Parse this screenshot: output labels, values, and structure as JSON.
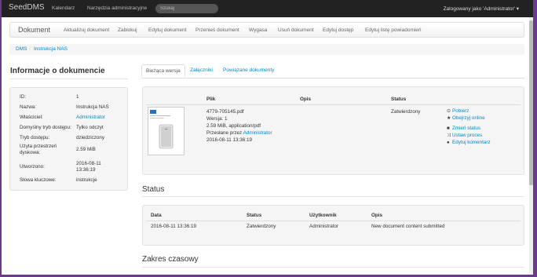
{
  "navbar": {
    "brand": "SeedDMS",
    "links": [
      "Kalendarz",
      "Narzędzia administracyjne"
    ],
    "search_placeholder": "Szukaj",
    "user": "Zalogowany jako 'Administrator' ▾"
  },
  "menubar": {
    "title": "Dokument",
    "items": [
      "Aktualizuj dokument",
      "Zablokuj",
      "Edytuj dokument",
      "Przenieś dokument",
      "Wygasa",
      "Usuń dokument",
      "Edytuj dostęp",
      "Edytuj listę powiadomień"
    ]
  },
  "breadcrumb": [
    "DMS",
    "Instrukcja NAS"
  ],
  "sidebar": {
    "heading": "Informacje o dokumencie",
    "rows": [
      {
        "label": "ID:",
        "value": "1"
      },
      {
        "label": "Nazwa:",
        "value": "Instrukcja NAS"
      },
      {
        "label": "Właściciel:",
        "value": "Administrator"
      },
      {
        "label": "Domyślny tryb dostępu:",
        "value": "Tylko odczyt"
      },
      {
        "label": "Tryb dostępu:",
        "value": "dziedziczony"
      },
      {
        "label": "Użyta przestrzeń dyskowa:",
        "value": "2.59 MiB"
      },
      {
        "label": "Utworzono:",
        "value": "2016-08-11 13:36:19"
      },
      {
        "label": "Słowa kluczowe:",
        "value": "instrukcje"
      }
    ]
  },
  "tabs": [
    "Bieżąca wersja",
    "Załączniki",
    "Powiązane dokumenty"
  ],
  "version": {
    "headers": [
      "Plik",
      "Opis",
      "Status"
    ],
    "filename": "4779-705145.pdf",
    "version_line": "Wersja: 1",
    "size_line": "2.59 MiB, application/pdf",
    "uploaded_prefix": "Przesłane przez",
    "uploaded_by": "Administrator",
    "date": "2016-08-11 13:36:19",
    "status": "Zatwierdzony",
    "actions": [
      {
        "icon": "download-icon",
        "glyph": "⊙",
        "label": "Pobierz"
      },
      {
        "icon": "star-icon",
        "glyph": "★",
        "label": "Obejrzyj online"
      },
      {
        "icon": "status-icon",
        "glyph": "■",
        "label": "Zmień status"
      },
      {
        "icon": "shuffle-icon",
        "glyph": "⤨",
        "label": "Ustaw proces"
      },
      {
        "icon": "comment-icon",
        "glyph": "●",
        "label": "Edytuj komentarz"
      }
    ]
  },
  "status_section": {
    "title": "Status",
    "headers": [
      "Data",
      "Status",
      "Użytkownik",
      "Opis"
    ],
    "row": [
      "2016-08-11 13:36:19",
      "Zatwierdzony",
      "Administrator",
      "New document content submitted"
    ]
  },
  "timeline_section": {
    "title": "Zakres czasowy"
  }
}
